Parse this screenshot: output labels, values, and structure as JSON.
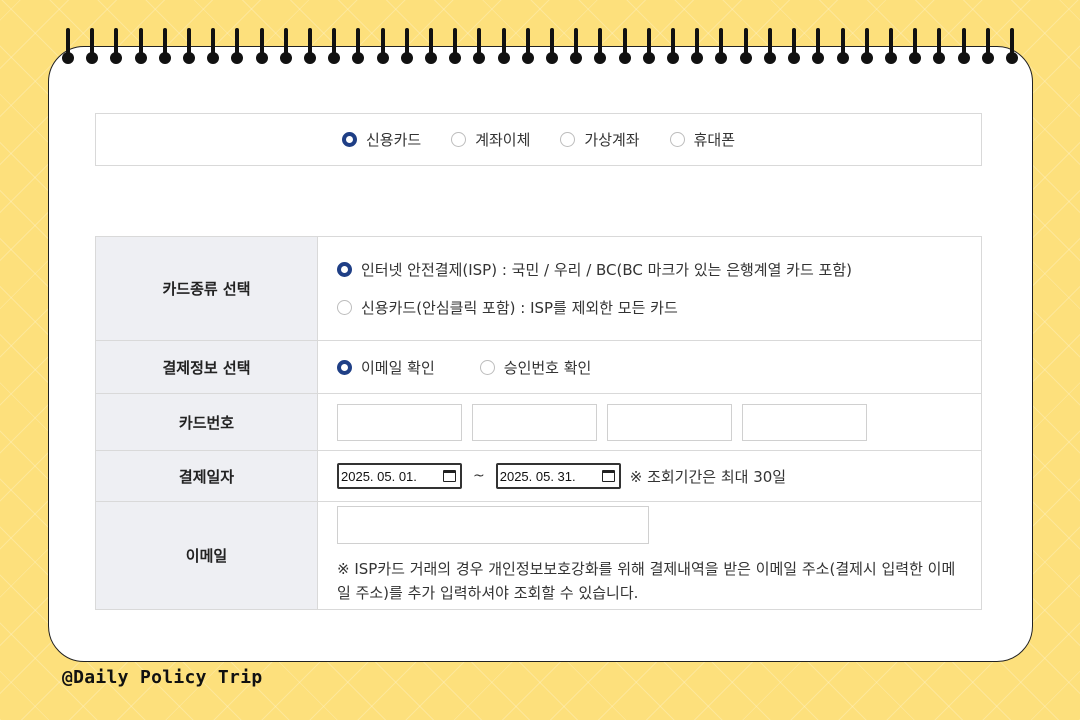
{
  "payment_methods": [
    {
      "label": "신용카드",
      "checked": true
    },
    {
      "label": "계좌이체",
      "checked": false
    },
    {
      "label": "가상계좌",
      "checked": false
    },
    {
      "label": "휴대폰",
      "checked": false
    }
  ],
  "form": {
    "card_type": {
      "label": "카드종류 선택",
      "options": [
        {
          "label": "인터넷 안전결제(ISP) : 국민 / 우리 / BC(BC 마크가 있는 은행계열 카드 포함)",
          "checked": true
        },
        {
          "label": "신용카드(안심클릭 포함) : ISP를 제외한 모든 카드",
          "checked": false
        }
      ]
    },
    "payment_info": {
      "label": "결제정보 선택",
      "options": [
        {
          "label": "이메일 확인",
          "checked": true
        },
        {
          "label": "승인번호 확인",
          "checked": false
        }
      ]
    },
    "card_number": {
      "label": "카드번호"
    },
    "payment_date": {
      "label": "결제일자",
      "from": "2025. 05. 01.",
      "to": "2025. 05. 31.",
      "separator": "~",
      "note": "※ 조회기간은 최대 30일"
    },
    "email": {
      "label": "이메일",
      "note": "※ ISP카드 거래의 경우 개인정보보호강화를 위해 결제내역을 받은 이메일 주소(결제시 입력한 이메일 주소)를 추가 입력하셔야 조회할 수 있습니다."
    }
  },
  "watermark": "@Daily Policy Trip"
}
